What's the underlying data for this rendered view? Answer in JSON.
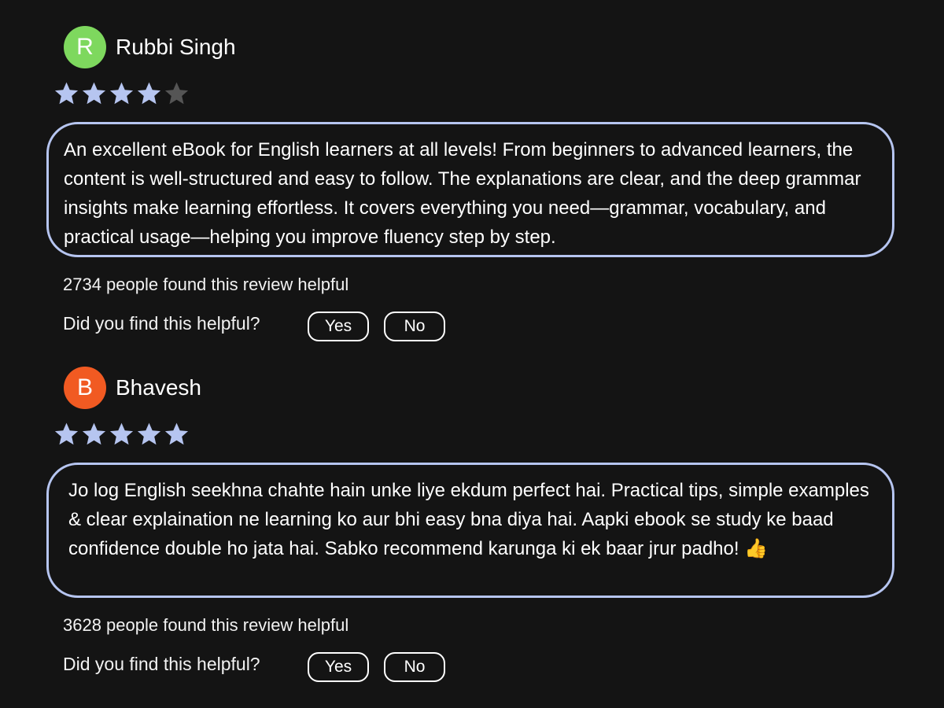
{
  "reviews": [
    {
      "avatar_initial": "R",
      "avatar_color": "#7ed85e",
      "name": "Rubbi Singh",
      "rating": 4,
      "rating_max": 5,
      "text": "An excellent eBook for English learners at all levels! From beginners to advanced learners, the content is well-structured and easy to follow. The explanations are clear, and the deep grammar insights make learning effortless. It covers everything you need—grammar, vocabulary, and practical usage—helping you improve fluency step by step.",
      "helpful_count_text": "2734 people found this review helpful",
      "helpful_question": "Did you find this helpful?",
      "yes_label": "Yes",
      "no_label": "No"
    },
    {
      "avatar_initial": "B",
      "avatar_color": "#f15a22",
      "name": "Bhavesh",
      "rating": 5,
      "rating_max": 5,
      "text": "Jo log English seekhna chahte hain unke liye ekdum perfect hai. Practical tips, simple examples & clear explaination ne learning ko aur bhi easy bna diya hai. Aapki ebook se study ke baad confidence double ho jata hai. Sabko recommend karunga ki ek baar jrur padho!",
      "emoji": "👍",
      "helpful_count_text": "3628 people found this review helpful",
      "helpful_question": "Did you find this helpful?",
      "yes_label": "Yes",
      "no_label": "No"
    }
  ],
  "colors": {
    "background": "#141414",
    "star_filled": "#b6c5f0",
    "star_empty": "#555555",
    "card_border": "#b6c5f0"
  }
}
